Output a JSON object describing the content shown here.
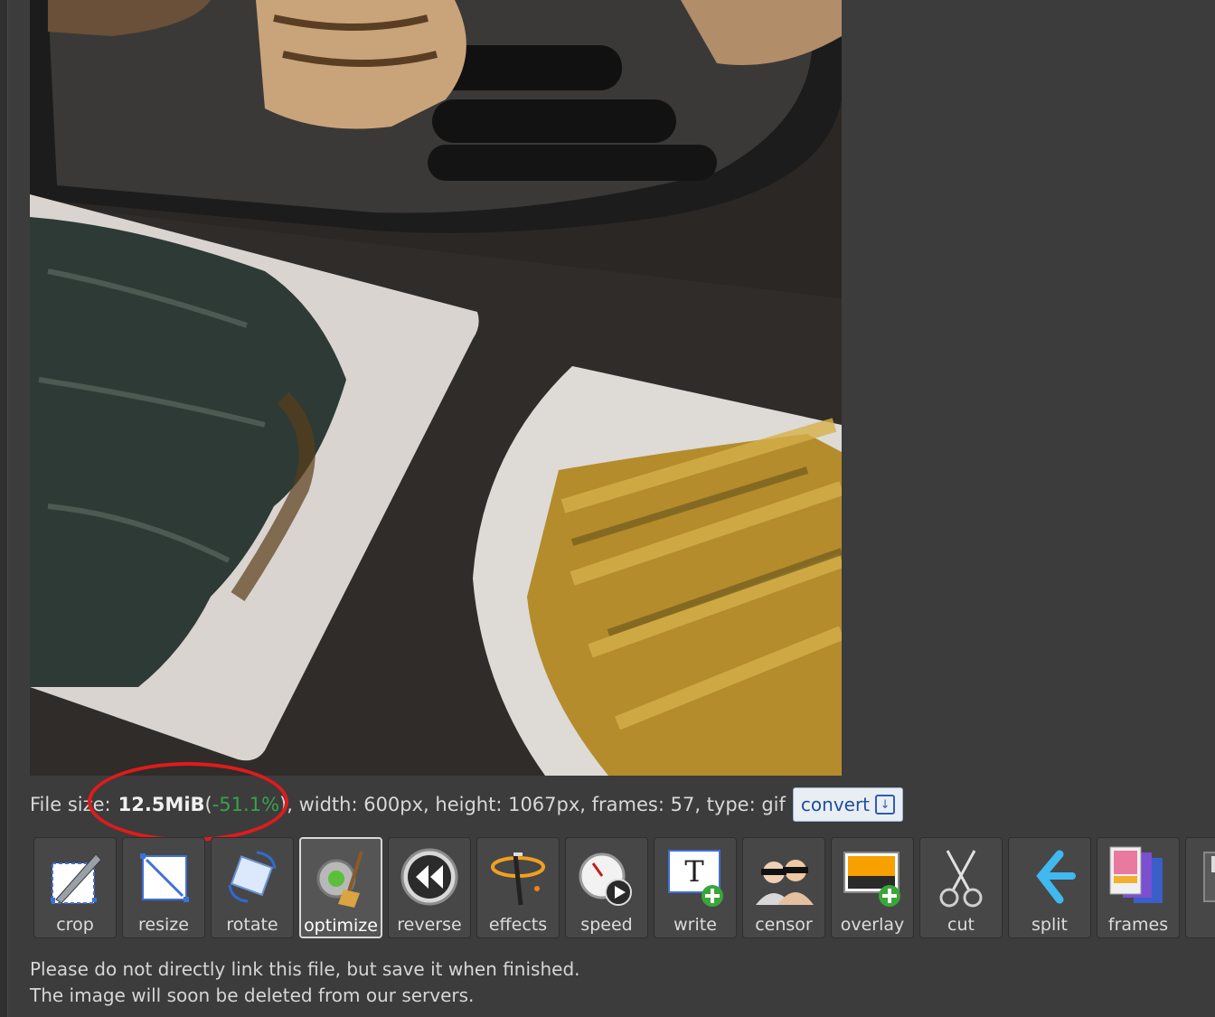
{
  "file_info": {
    "size_label": "File size:",
    "size_value": "12.5MiB",
    "percent_open": " (",
    "percent": "-51.1%",
    "rest": "), width: 600px, height: 1067px, frames: 57, type: gif",
    "convert_label": "convert"
  },
  "tools": [
    {
      "name": "crop",
      "label": "crop",
      "icon": "crop-icon"
    },
    {
      "name": "resize",
      "label": "resize",
      "icon": "resize-icon"
    },
    {
      "name": "rotate",
      "label": "rotate",
      "icon": "rotate-icon"
    },
    {
      "name": "optimize",
      "label": "optimize",
      "icon": "optimize-icon",
      "active": true
    },
    {
      "name": "reverse",
      "label": "reverse",
      "icon": "reverse-icon"
    },
    {
      "name": "effects",
      "label": "effects",
      "icon": "effects-icon"
    },
    {
      "name": "speed",
      "label": "speed",
      "icon": "speed-icon"
    },
    {
      "name": "write",
      "label": "write",
      "icon": "write-icon"
    },
    {
      "name": "censor",
      "label": "censor",
      "icon": "censor-icon"
    },
    {
      "name": "overlay",
      "label": "overlay",
      "icon": "overlay-icon"
    },
    {
      "name": "cut",
      "label": "cut",
      "icon": "cut-icon"
    },
    {
      "name": "split",
      "label": "split",
      "icon": "split-icon"
    },
    {
      "name": "frames",
      "label": "frames",
      "icon": "frames-icon"
    }
  ],
  "notice": {
    "line1": "Please do not directly link this file, but save it when finished.",
    "line2": "The image will soon be deleted from our servers."
  },
  "colors": {
    "background": "#3c3c3c",
    "annotation": "#e01b1b",
    "percent_green": "#3aa14a",
    "convert_text": "#1e4f99"
  }
}
